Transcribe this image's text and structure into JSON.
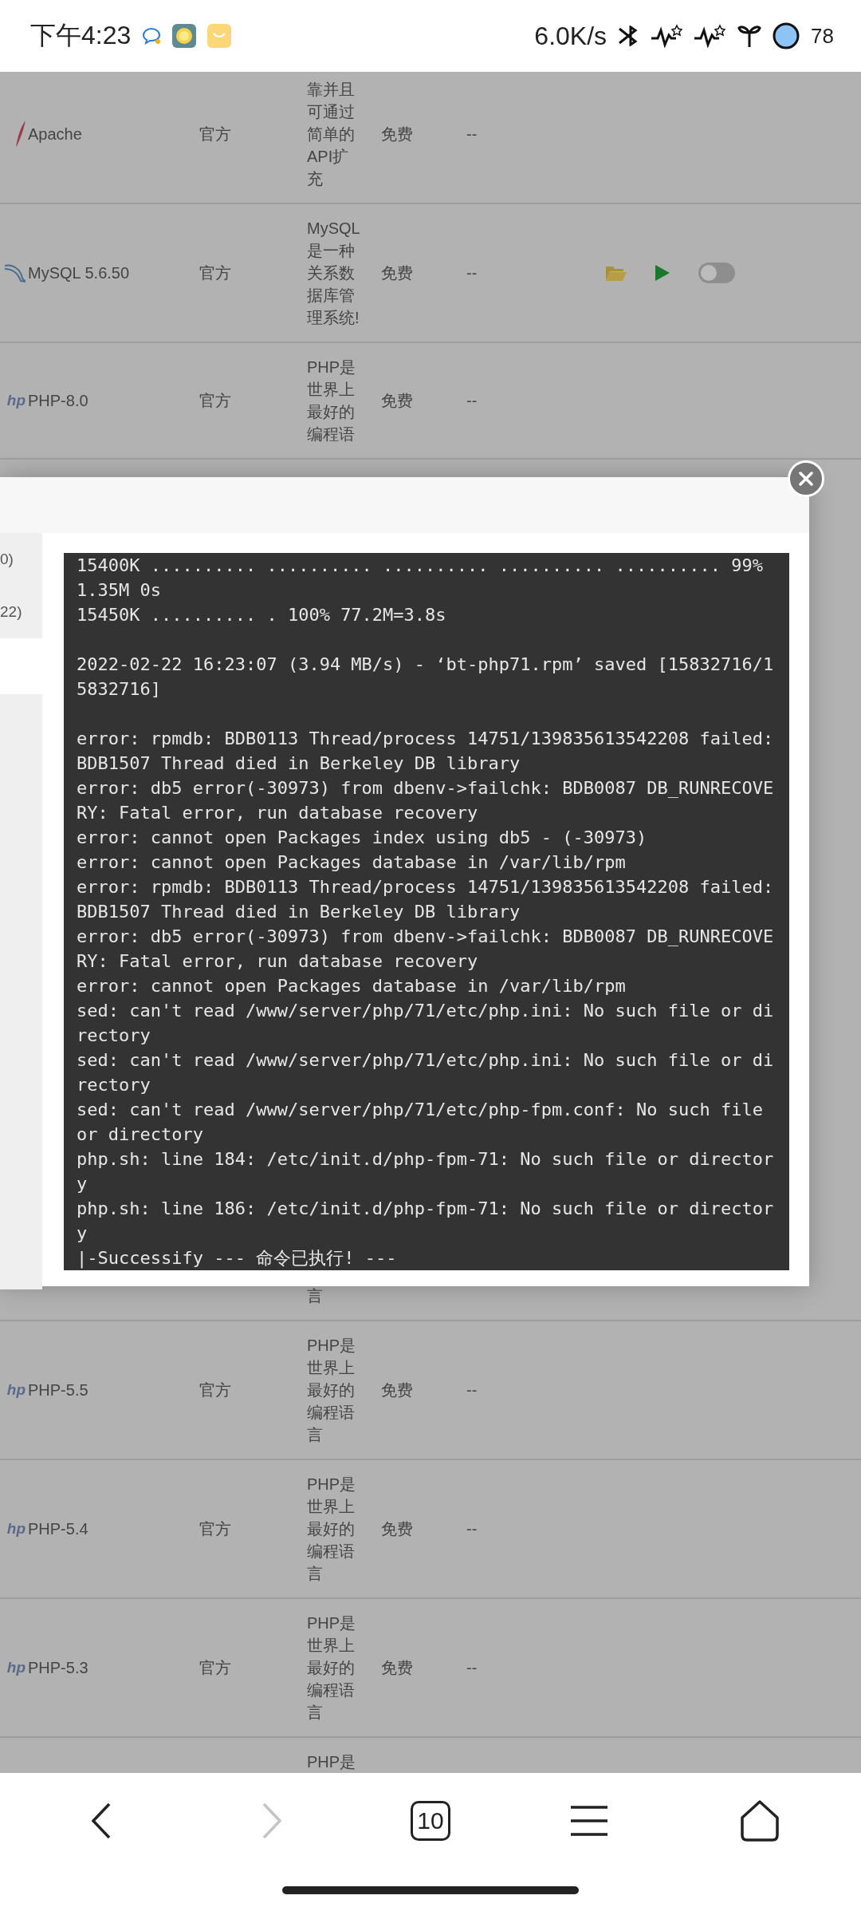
{
  "status_bar": {
    "time": "下午4:23",
    "speed": "6.0K/s",
    "battery": "78"
  },
  "table": {
    "rows_top": [
      {
        "kind": "feather",
        "name": "Apache",
        "source": "官方",
        "desc": "靠并且可通过简单的API扩充",
        "price": "免费",
        "expiry": "--"
      },
      {
        "kind": "dolphin",
        "name": "MySQL 5.6.50",
        "source": "官方",
        "desc": "MySQL是一种关系数据库管理系统!",
        "price": "免费",
        "expiry": "--",
        "actions": {
          "toggle_on": false
        }
      },
      {
        "kind": "php",
        "logo_text": "hp",
        "name": "PHP-8.0",
        "source": "官方",
        "desc": "PHP是世界上最好的编程语",
        "price": "免费",
        "expiry": "--"
      }
    ],
    "rows_bottom": [
      {
        "desc": "言"
      },
      {
        "kind": "php",
        "logo_text": "hp",
        "name": "PHP-5.5",
        "source": "官方",
        "desc": "PHP是世界上最好的编程语言",
        "price": "免费",
        "expiry": "--"
      },
      {
        "kind": "php",
        "logo_text": "hp",
        "name": "PHP-5.4",
        "source": "官方",
        "desc": "PHP是世界上最好的编程语言",
        "price": "免费",
        "expiry": "--"
      },
      {
        "kind": "php",
        "logo_text": "hp",
        "name": "PHP-5.3",
        "source": "官方",
        "desc": "PHP是世界上最好的编程语言",
        "price": "免费",
        "expiry": "--"
      },
      {
        "desc": "PHP是"
      }
    ]
  },
  "dialog": {
    "sidebar_items": [
      "0)",
      "22)"
    ],
    "terminal": {
      "blocks": [
        [
          "15400K .......... .......... .......... .......... .......... 99%",
          "1.35M 0s",
          "15450K .......... . 100% 77.2M=3.8s"
        ],
        [
          "2022-02-22 16:23:07 (3.94 MB/s) - ‘bt-php71.rpm’ saved [15832716/15832716]"
        ],
        [
          "error: rpmdb: BDB0113 Thread/process 14751/139835613542208 failed: BDB1507 Thread died in Berkeley DB library",
          "error: db5 error(-30973) from dbenv->failchk: BDB0087 DB_RUNRECOVERY: Fatal error, run database recovery",
          "error: cannot open Packages index using db5 - (-30973)",
          "error: cannot open Packages database in /var/lib/rpm",
          "error: rpmdb: BDB0113 Thread/process 14751/139835613542208 failed: BDB1507 Thread died in Berkeley DB library",
          "error: db5 error(-30973) from dbenv->failchk: BDB0087 DB_RUNRECOVERY: Fatal error, run database recovery",
          "error: cannot open Packages database in /var/lib/rpm",
          "sed: can't read /www/server/php/71/etc/php.ini: No such file or directory",
          "sed: can't read /www/server/php/71/etc/php.ini: No such file or directory",
          "sed: can't read /www/server/php/71/etc/php-fpm.conf: No such file or directory",
          "php.sh: line 184: /etc/init.d/php-fpm-71: No such file or directory",
          "php.sh: line 186: /etc/init.d/php-fpm-71: No such file or directory",
          "|-Successify --- 命令已执行! ---"
        ]
      ]
    }
  },
  "nav": {
    "tabs_count": "10",
    "forward_disabled": true
  }
}
